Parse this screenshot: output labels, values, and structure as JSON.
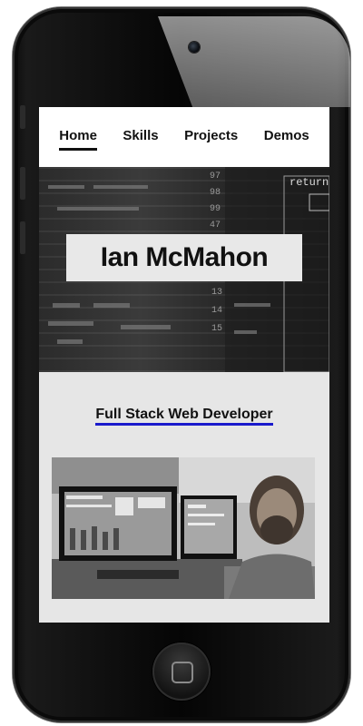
{
  "nav": {
    "items": [
      {
        "label": "Home",
        "active": true
      },
      {
        "label": "Skills",
        "active": false
      },
      {
        "label": "Projects",
        "active": false
      },
      {
        "label": "Demos",
        "active": false
      }
    ]
  },
  "hero": {
    "name": "Ian McMahon",
    "code_snippet": "return"
  },
  "section": {
    "subtitle": "Full Stack Web Developer"
  },
  "colors": {
    "nav_bg": "#ffffff",
    "title_box_bg": "#e8e8e8",
    "content_bg": "#e6e6e6",
    "link_underline": "#1a1acc"
  }
}
